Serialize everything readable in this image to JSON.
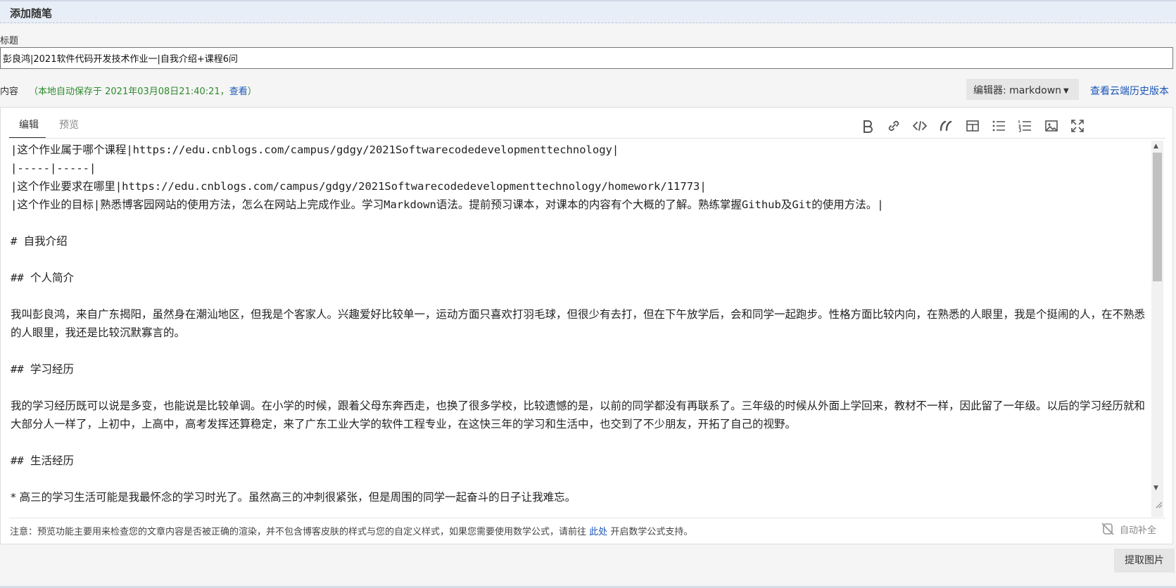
{
  "header": {
    "title": "添加随笔"
  },
  "title_field": {
    "label": "标题",
    "value": "彭良鸿|2021软件代码开发技术作业一|自我介绍+课程6问"
  },
  "content_field": {
    "label": "内容",
    "autosave_prefix": "（本地自动保存于 2021年03月08日21:40:21，",
    "autosave_link": "查看",
    "autosave_suffix": "）"
  },
  "editor_select": {
    "label": "编辑器: markdown"
  },
  "cloud_history": "查看云端历史版本",
  "tabs": [
    {
      "label": "编辑",
      "active": true
    },
    {
      "label": "预览",
      "active": false
    }
  ],
  "toolbar_icons": [
    "bold-icon",
    "link-icon",
    "code-icon",
    "quote-icon",
    "table-icon",
    "bullet-list-icon",
    "numbered-list-icon",
    "image-icon",
    "fullscreen-icon"
  ],
  "editor_lines": [
    "|这个作业属于哪个课程|https://edu.cnblogs.com/campus/gdgy/2021Softwarecodedevelopmenttechnology|",
    "|-----|-----|",
    "|这个作业要求在哪里|https://edu.cnblogs.com/campus/gdgy/2021Softwarecodedevelopmenttechnology/homework/11773|",
    "|这个作业的目标|熟悉博客园网站的使用方法，怎么在网站上完成作业。学习Markdown语法。提前预习课本，对课本的内容有个大概的了解。熟练掌握Github及Git的使用方法。|",
    "",
    "# 自我介绍",
    "",
    "## 个人简介",
    "",
    "我叫彭良鸿，来自广东揭阳，虽然身在潮汕地区，但我是个客家人。兴趣爱好比较单一，运动方面只喜欢打羽毛球，但很少有去打，但在下午放学后，会和同学一起跑步。性格方面比较内向，在熟悉的人眼里，我是个挺闹的人，在不熟悉的人眼里，我还是比较沉默寡言的。",
    "",
    "## 学习经历",
    "",
    "我的学习经历既可以说是多变，也能说是比较单调。在小学的时候，跟着父母东奔西走，也换了很多学校，比较遗憾的是，以前的同学都没有再联系了。三年级的时候从外面上学回来，教材不一样，因此留了一年级。以后的学习经历就和大部分人一样了，上初中，上高中，高考发挥还算稳定，来了广东工业大学的软件工程专业，在这快三年的学习和生活中，也交到了不少朋友，开拓了自己的视野。",
    "",
    "## 生活经历",
    "",
    "* 高三的学习生活可能是我最怀念的学习时光了。虽然高三的冲刺很紧张，但是周围的同学一起奋斗的日子让我难忘。"
  ],
  "note": {
    "prefix": "注意：预览功能主要用来检查您的文章内容是否被正确的渲染，并不包含博客皮肤的样式与您的自定义样式，如果您需要使用数学公式，请前往",
    "link": "此处",
    "suffix": "开启数学公式支持。"
  },
  "autocomplete": "自动补全",
  "extract_button": "提取图片"
}
